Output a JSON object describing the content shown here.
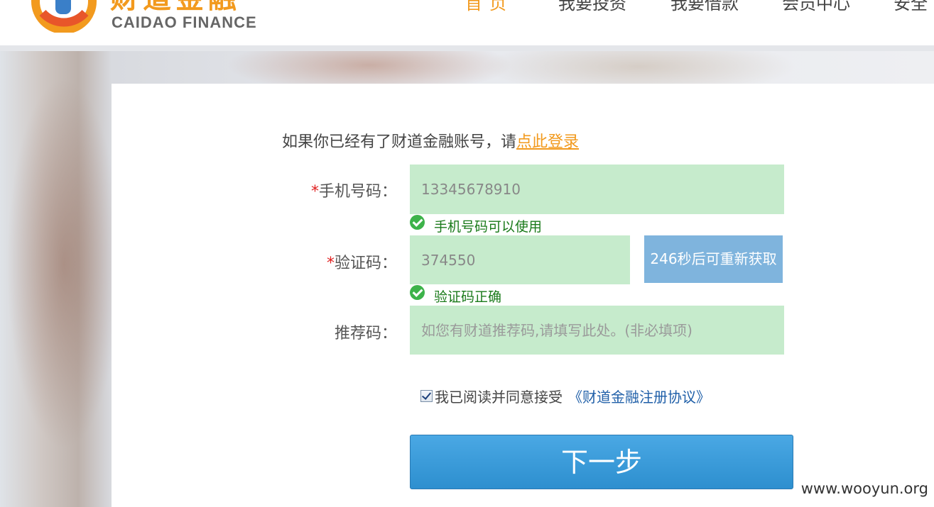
{
  "header": {
    "logo_cn": "财道金融",
    "logo_en": "CAIDAO FINANCE",
    "nav": [
      {
        "label": "首页"
      },
      {
        "label": "我要投资"
      },
      {
        "label": "我要借款"
      },
      {
        "label": "会员中心"
      },
      {
        "label": "安全"
      }
    ],
    "active_nav": "首页"
  },
  "form": {
    "intro_text": "如果你已经有了财道金融账号，请",
    "login_link": "点此登录",
    "phone": {
      "required_mark": "*",
      "label": "手机号码：",
      "value": "13345678910",
      "status": "手机号码可以使用"
    },
    "code": {
      "required_mark": "*",
      "label": "验证码：",
      "value": "374550",
      "status": "验证码正确",
      "resend_label": "246秒后可重新获取"
    },
    "referral": {
      "label": "推荐码：",
      "placeholder": "如您有财道推荐码,请填写此处。(非必填项)"
    },
    "agreement": {
      "checked": true,
      "text": "我已阅读并同意接受",
      "link": "《财道金融注册协议》"
    },
    "next_label": "下一步"
  },
  "watermark": "www.wooyun.org",
  "colors": {
    "brand_orange": "#f29a1e",
    "field_bg": "#c6ebcc",
    "success_green": "#1a7a1a",
    "button_blue": "#3a9ad9",
    "resend_blue": "#7fb4dd",
    "required_red": "#e02020"
  }
}
